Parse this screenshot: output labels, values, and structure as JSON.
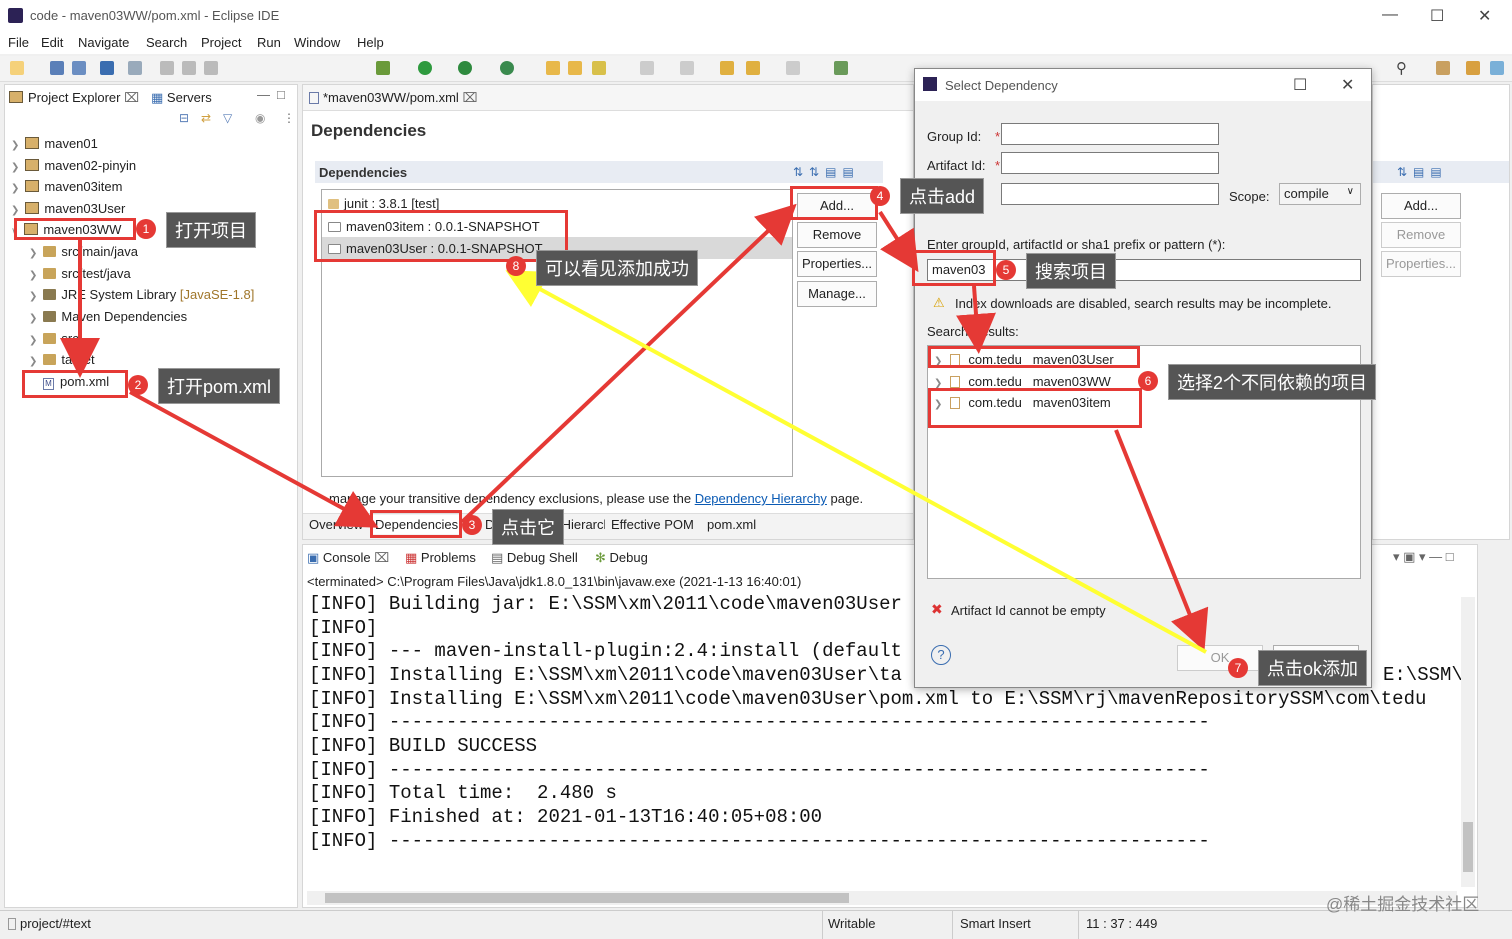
{
  "window": {
    "title": "code - maven03WW/pom.xml - Eclipse IDE"
  },
  "menu": [
    "File",
    "Edit",
    "Navigate",
    "Search",
    "Project",
    "Run",
    "Window",
    "Help"
  ],
  "left": {
    "tab1": "Project Explorer",
    "tab2": "Servers",
    "tree": [
      "maven01",
      "maven02-pinyin",
      "maven03item",
      "maven03User",
      "maven03WW",
      "src/main/java",
      "src/test/java",
      "JRE System Library",
      "[JavaSE-1.8]",
      "Maven Dependencies",
      "src",
      "target",
      "pom.xml"
    ]
  },
  "editor": {
    "tab": "*maven03WW/pom.xml",
    "title": "Dependencies",
    "section": "Dependencies",
    "deps": [
      "junit : 3.8.1 [test]",
      "maven03item : 0.0.1-SNAPSHOT",
      "maven03User : 0.0.1-SNAPSHOT"
    ],
    "buttons": [
      "Add...",
      "Remove",
      "Properties...",
      "Manage..."
    ],
    "note_pre": "manage your transitive dependency exclusions, please use the",
    "note_link": "Dependency Hierarchy",
    "note_post": "page.",
    "bottom_tabs": [
      "Overview",
      "Dependencies",
      "Dependency Hierarchy",
      "Effective POM",
      "pom.xml"
    ],
    "right_buttons": [
      "Add...",
      "Remove",
      "Properties..."
    ]
  },
  "console": {
    "tabs": [
      "Console",
      "Problems",
      "Debug Shell",
      "Debug"
    ],
    "terminated": "<terminated> C:\\Program Files\\Java\\jdk1.8.0_131\\bin\\javaw.exe (2021-1-13 16:40:01)",
    "lines": [
      "[INFO] Building jar: E:\\SSM\\xm\\2011\\code\\maven03User",
      "[INFO]",
      "[INFO] --- maven-install-plugin:2.4:install (default",
      "[INFO] Installing E:\\SSM\\xm\\2011\\code\\maven03User\\ta",
      "[INFO] Installing E:\\SSM\\xm\\2011\\code\\maven03User\\pom.xml to E:\\SSM\\rj\\mavenRepositorySSM\\com\\tedu",
      "[INFO] ------------------------------------------------------------------------",
      "[INFO] BUILD SUCCESS",
      "[INFO] ------------------------------------------------------------------------",
      "[INFO] Total time:  2.480 s",
      "[INFO] Finished at: 2021-01-13T16:40:05+08:00",
      "[INFO] ------------------------------------------------------------------------"
    ],
    "right_fragment": "E:\\SSM\\"
  },
  "dialog": {
    "title": "Select Dependency",
    "group_label": "Group Id:",
    "artifact_label": "Artifact Id:",
    "scope_label": "Scope:",
    "scope_value": "compile",
    "search_label": "Enter groupId, artifactId or sha1 prefix or pattern (*):",
    "search_value": "maven03",
    "warning": "Index downloads are disabled, search results may be incomplete.",
    "results_label": "Search Results:",
    "results": [
      {
        "g": "com.tedu",
        "a": "maven03User"
      },
      {
        "g": "com.tedu",
        "a": "maven03WW"
      },
      {
        "g": "com.tedu",
        "a": "maven03item"
      }
    ],
    "error": "Artifact Id cannot be empty",
    "ok": "OK",
    "cancel": "Cancel"
  },
  "annotations": {
    "c1": "打开项目",
    "c2": "打开pom.xml",
    "c3": "点击它",
    "c4": "点击add",
    "c5": "搜索项目",
    "c6": "选择2个不同依赖的项目",
    "c7": "点击ok添加",
    "c8": "可以看见添加成功",
    "n": [
      "1",
      "2",
      "3",
      "4",
      "5",
      "6",
      "7",
      "8"
    ]
  },
  "status": {
    "path": "project/#text",
    "writable": "Writable",
    "insert": "Smart Insert",
    "pos": "11 : 37 : 449"
  },
  "watermark": "@稀土掘金技术社区",
  "colors": {
    "annotation_red": "#e53935",
    "arrow_yellow": "#ffff33",
    "callout_bg": "#555555"
  }
}
